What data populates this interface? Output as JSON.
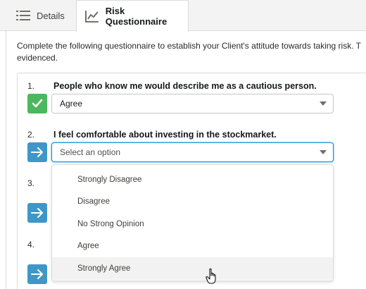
{
  "tabs": [
    {
      "label": "Details",
      "icon": "list-icon"
    },
    {
      "label": "Risk Questionnaire",
      "icon": "line-chart-icon",
      "active": true
    }
  ],
  "intro": {
    "line1": "Complete the following questionnaire to establish your Client's attitude towards taking risk. T",
    "line2": "evidenced."
  },
  "questions": [
    {
      "number": "1.",
      "text": "People who know me would describe me as a cautious person.",
      "status": "answered",
      "value": "Agree"
    },
    {
      "number": "2.",
      "text": "I feel comfortable about investing in the stockmarket.",
      "status": "pending",
      "placeholder": "Select an option"
    },
    {
      "number": "3.",
      "status": "pending"
    },
    {
      "number": "4.",
      "status": "pending"
    }
  ],
  "dropdown": {
    "options": [
      "Strongly Disagree",
      "Disagree",
      "No Strong Opinion",
      "Agree",
      "Strongly Agree"
    ],
    "hovered": "Strongly Agree"
  },
  "colors": {
    "answered": "#4bb75f",
    "pending": "#3e97c8",
    "focus": "#1b96d4"
  }
}
